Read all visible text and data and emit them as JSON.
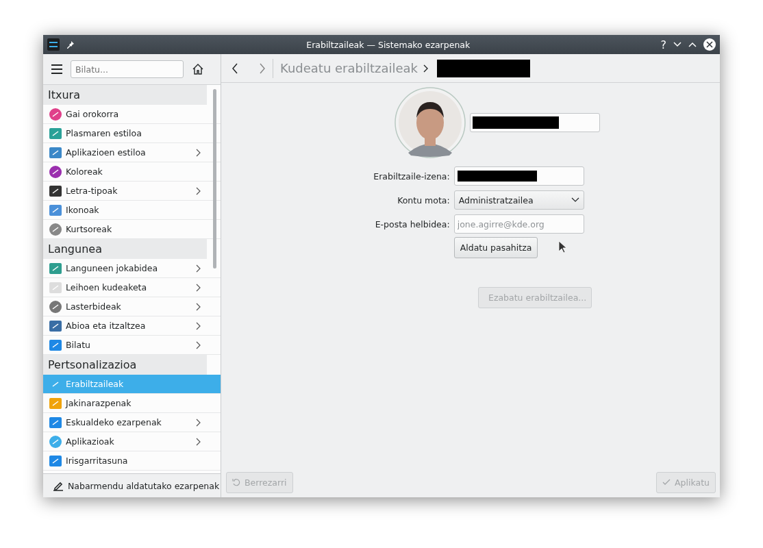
{
  "window": {
    "title": "Erabiltzaileak — Sistemako ezarpenak",
    "title_buttons": [
      "?"
    ]
  },
  "sidebar": {
    "search": {
      "placeholder": "Bilatu..."
    },
    "sections": [
      {
        "title": "Itxura",
        "items": [
          {
            "label": "Gai orokorra",
            "expandable": false,
            "selected": false
          },
          {
            "label": "Plasmaren estiloa",
            "expandable": false,
            "selected": false
          },
          {
            "label": "Aplikazioen estiloa",
            "expandable": true,
            "selected": false
          },
          {
            "label": "Koloreak",
            "expandable": false,
            "selected": false
          },
          {
            "label": "Letra-tipoak",
            "expandable": true,
            "selected": false
          },
          {
            "label": "Ikonoak",
            "expandable": false,
            "selected": false
          },
          {
            "label": "Kurtsoreak",
            "expandable": false,
            "selected": false
          }
        ]
      },
      {
        "title": "Langunea",
        "items": [
          {
            "label": "Languneen jokabidea",
            "expandable": true,
            "selected": false
          },
          {
            "label": "Leihoen kudeaketa",
            "expandable": true,
            "selected": false
          },
          {
            "label": "Lasterbideak",
            "expandable": true,
            "selected": false
          },
          {
            "label": "Abioa eta itzaltzea",
            "expandable": true,
            "selected": false
          },
          {
            "label": "Bilatu",
            "expandable": true,
            "selected": false
          }
        ]
      },
      {
        "title": "Pertsonalizazioa",
        "items": [
          {
            "label": "Erabiltzaileak",
            "expandable": false,
            "selected": true
          },
          {
            "label": "Jakinarazpenak",
            "expandable": false,
            "selected": false
          },
          {
            "label": "Eskualdeko ezarpenak",
            "expandable": true,
            "selected": false
          },
          {
            "label": "Aplikazioak",
            "expandable": true,
            "selected": false
          },
          {
            "label": "Irisgarritasuna",
            "expandable": false,
            "selected": false
          }
        ]
      }
    ],
    "highlight_button": "Nabarmendu aldatutako ezarpenak"
  },
  "breadcrumb": {
    "title": "Kudeatu erabiltzaileak",
    "current_redacted": true
  },
  "user": {
    "name_redacted": true,
    "fields": [
      {
        "kind": "text",
        "label": "Erabiltzaile-izena:",
        "redacted": true
      },
      {
        "kind": "dropdown",
        "label": "Kontu mota:",
        "value": "Administratzailea"
      },
      {
        "kind": "text",
        "label": "E-posta helbidea:",
        "placeholder": "jone.agirre@kde.org"
      }
    ],
    "change_password": {
      "label": "Aldatu pasahitza"
    },
    "delete_user": {
      "label": "Ezabatu erabiltzailea...",
      "disabled": true
    }
  },
  "footer": {
    "reset": {
      "label": "Berrezarri",
      "disabled": true
    },
    "apply": {
      "label": "Aplikatu",
      "disabled": true
    }
  }
}
